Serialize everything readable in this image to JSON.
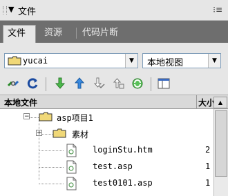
{
  "panel": {
    "title": "文件",
    "menu_icon": "options-menu-icon"
  },
  "tabs": [
    {
      "label": "文件",
      "active": true
    },
    {
      "label": "资源",
      "active": false
    },
    {
      "label": "代码片断",
      "active": false
    }
  ],
  "site": {
    "site_selector_value": "yucai",
    "view_selector_value": "本地视图"
  },
  "toolbar": {
    "icons": [
      "connect-icon",
      "refresh-icon",
      "get-files-icon",
      "put-files-icon",
      "check-out-icon",
      "check-in-icon",
      "synchronize-icon",
      "expand-panel-icon"
    ]
  },
  "header": {
    "name_column": "本地文件",
    "size_column": "大小"
  },
  "tree": [
    {
      "name": "asp项目1",
      "type": "folder",
      "level": 1,
      "expanded": true,
      "size": ""
    },
    {
      "name": "素材",
      "type": "folder",
      "level": 2,
      "expanded": false,
      "size": ""
    },
    {
      "name": "loginStu.htm",
      "type": "file",
      "level": 2,
      "size": "2"
    },
    {
      "name": "test.asp",
      "type": "file",
      "level": 2,
      "size": "1"
    },
    {
      "name": "test0101.asp",
      "type": "file",
      "level": 2,
      "size": "1"
    }
  ],
  "colors": {
    "folder": "#f0d878",
    "folder_outline": "#333333",
    "tab_bar": "#6e6e6e"
  }
}
